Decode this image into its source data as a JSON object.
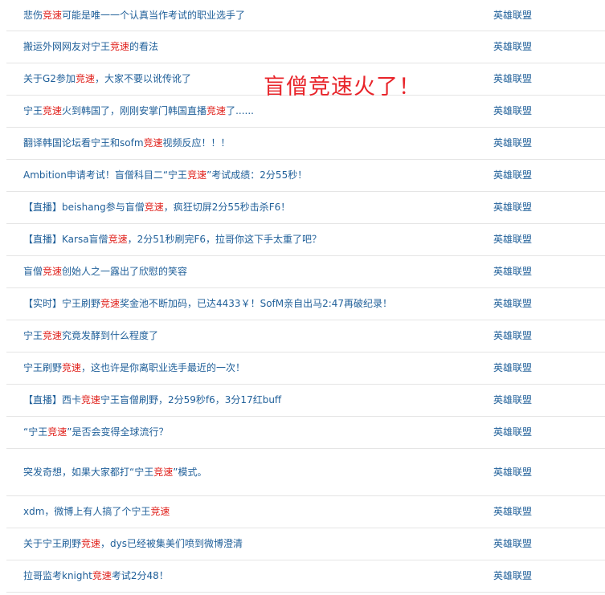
{
  "overlay_text": "盲僧竞速火了！",
  "rows": [
    {
      "height": 39,
      "segments": [
        {
          "t": "悲伤"
        },
        {
          "t": "竞速",
          "hl": true
        },
        {
          "t": "可能是唯一一个认真当作考试的职业选手了"
        }
      ],
      "category": "英雄联盟"
    },
    {
      "height": 40,
      "segments": [
        {
          "t": "搬运外网网友对宁王"
        },
        {
          "t": "竞速",
          "hl": true
        },
        {
          "t": "的看法"
        }
      ],
      "category": "英雄联盟"
    },
    {
      "height": 40,
      "segments": [
        {
          "t": "关于G2参加"
        },
        {
          "t": "竞速",
          "hl": true
        },
        {
          "t": "，大家不要以讹传讹了"
        }
      ],
      "category": "英雄联盟"
    },
    {
      "height": 40,
      "segments": [
        {
          "t": "宁王"
        },
        {
          "t": "竞速",
          "hl": true
        },
        {
          "t": "火到韩国了，刚刚安掌门韩国直播"
        },
        {
          "t": "竞速",
          "hl": true
        },
        {
          "t": "了......"
        }
      ],
      "category": "英雄联盟"
    },
    {
      "height": 40,
      "segments": [
        {
          "t": "翻译韩国论坛看宁王和sofm"
        },
        {
          "t": "竞速",
          "hl": true
        },
        {
          "t": "视频反应！！！"
        }
      ],
      "category": "英雄联盟"
    },
    {
      "height": 40,
      "segments": [
        {
          "t": "Ambition申请考试！盲僧科目二“宁王"
        },
        {
          "t": "竞速",
          "hl": true
        },
        {
          "t": "”考试成绩：2分55秒！"
        }
      ],
      "category": "英雄联盟"
    },
    {
      "height": 40,
      "segments": [
        {
          "t": "【直播】beishang参与盲僧"
        },
        {
          "t": "竞速",
          "hl": true
        },
        {
          "t": "，疯狂切屏2分55秒击杀F6！"
        }
      ],
      "category": "英雄联盟"
    },
    {
      "height": 40,
      "segments": [
        {
          "t": "【直播】Karsa盲僧"
        },
        {
          "t": "竞速",
          "hl": true
        },
        {
          "t": "，2分51秒刷完F6，拉哥你这下手太重了吧？"
        }
      ],
      "category": "英雄联盟"
    },
    {
      "height": 40,
      "segments": [
        {
          "t": "盲僧"
        },
        {
          "t": "竞速",
          "hl": true
        },
        {
          "t": "创始人之一露出了欣慰的笑容"
        }
      ],
      "category": "英雄联盟"
    },
    {
      "height": 40,
      "segments": [
        {
          "t": "【实时】宁王刷野"
        },
        {
          "t": "竞速",
          "hl": true
        },
        {
          "t": "奖金池不断加码，已达4433￥！SofM亲自出马2:47再破纪录！"
        }
      ],
      "category": "英雄联盟"
    },
    {
      "height": 40,
      "segments": [
        {
          "t": "宁王"
        },
        {
          "t": "竞速",
          "hl": true
        },
        {
          "t": "究竟发酵到什么程度了"
        }
      ],
      "category": "英雄联盟"
    },
    {
      "height": 40,
      "segments": [
        {
          "t": "宁王刷野"
        },
        {
          "t": "竞速",
          "hl": true
        },
        {
          "t": "，这也许是你离职业选手最近的一次！"
        }
      ],
      "category": "英雄联盟"
    },
    {
      "height": 40,
      "segments": [
        {
          "t": "【直播】西卡"
        },
        {
          "t": "竞速",
          "hl": true
        },
        {
          "t": "宁王盲僧刷野，2分59秒f6，3分17红buff"
        }
      ],
      "category": "英雄联盟"
    },
    {
      "height": 40,
      "segments": [
        {
          "t": "“宁王"
        },
        {
          "t": "竞速",
          "hl": true
        },
        {
          "t": "”是否会变得全球流行？"
        }
      ],
      "category": "英雄联盟"
    },
    {
      "height": 59,
      "segments": [
        {
          "t": "突发奇想，如果大家都打“宁王"
        },
        {
          "t": "竞速",
          "hl": true
        },
        {
          "t": "”模式。"
        }
      ],
      "category": "英雄联盟"
    },
    {
      "height": 40,
      "segments": [
        {
          "t": "xdm，微博上有人搞了个宁王"
        },
        {
          "t": "竞速",
          "hl": true
        }
      ],
      "category": "英雄联盟"
    },
    {
      "height": 40,
      "segments": [
        {
          "t": "关于宁王刷野"
        },
        {
          "t": "竞速",
          "hl": true
        },
        {
          "t": "，dys已经被集美们喷到微博澄清"
        }
      ],
      "category": "英雄联盟"
    },
    {
      "height": 40,
      "segments": [
        {
          "t": "拉哥监考knight"
        },
        {
          "t": "竞速",
          "hl": true
        },
        {
          "t": "考试2分48！"
        }
      ],
      "category": "英雄联盟"
    }
  ],
  "colors": {
    "link": "#1f5f99",
    "highlight": "#e0211c",
    "overlay": "#e8242a",
    "divider": "#e5e5e5"
  }
}
